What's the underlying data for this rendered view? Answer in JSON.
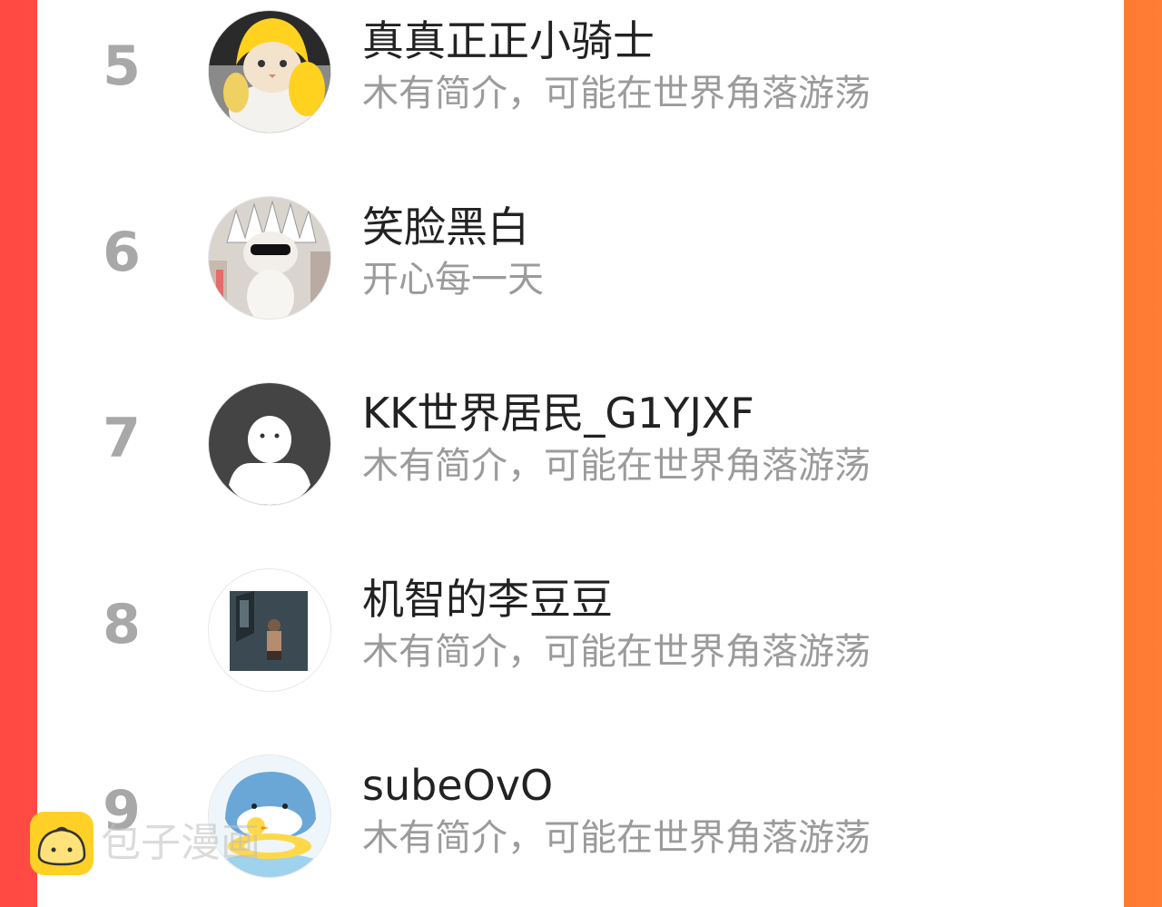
{
  "ranking": {
    "entries": [
      {
        "rank": "5",
        "name": "真真正正小骑士",
        "bio": "木有简介，可能在世界角落游荡",
        "avatar": "yellow-raincoat-cat-avatar"
      },
      {
        "rank": "6",
        "name": "笑脸黑白",
        "bio": "开心每一天",
        "avatar": "sunglasses-cat-avatar"
      },
      {
        "rank": "7",
        "name": "KK世界居民_G1YJXF",
        "bio": "木有简介，可能在世界角落游荡",
        "avatar": "default-user-avatar"
      },
      {
        "rank": "8",
        "name": "机智的李豆豆",
        "bio": "木有简介，可能在世界角落游荡",
        "avatar": "dark-room-figure-avatar"
      },
      {
        "rank": "9",
        "name": "subeOvO",
        "bio": "木有简介，可能在世界角落游荡",
        "avatar": "penguin-duck-float-avatar"
      }
    ]
  },
  "watermark": {
    "text": "包子漫画",
    "logo": "bun-face-logo"
  },
  "colors": {
    "frame_left": "#ff4a44",
    "frame_right": "#ff7d34",
    "rank": "#a8a8a8",
    "name": "#222222",
    "bio": "#9b9b9b",
    "logo": "#ffd126"
  }
}
